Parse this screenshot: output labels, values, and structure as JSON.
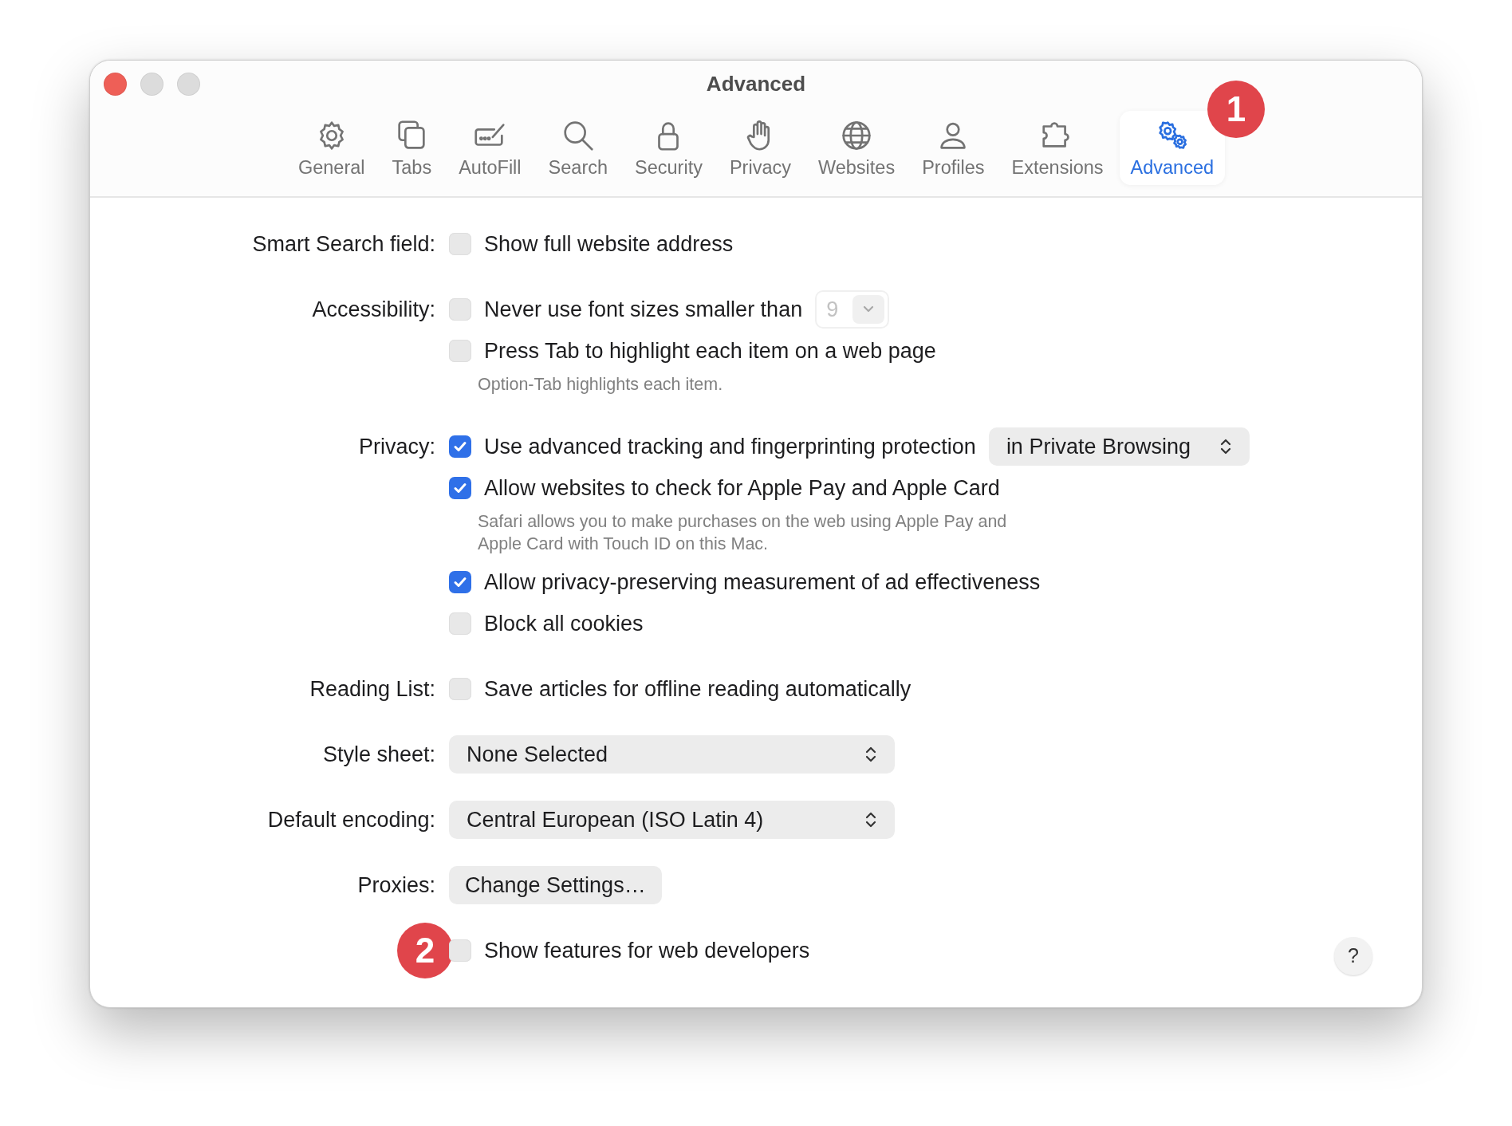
{
  "window": {
    "title": "Advanced"
  },
  "tabs": [
    {
      "label": "General",
      "selected": false
    },
    {
      "label": "Tabs",
      "selected": false
    },
    {
      "label": "AutoFill",
      "selected": false
    },
    {
      "label": "Search",
      "selected": false
    },
    {
      "label": "Security",
      "selected": false
    },
    {
      "label": "Privacy",
      "selected": false
    },
    {
      "label": "Websites",
      "selected": false
    },
    {
      "label": "Profiles",
      "selected": false
    },
    {
      "label": "Extensions",
      "selected": false
    },
    {
      "label": "Advanced",
      "selected": true,
      "badge": "1"
    }
  ],
  "sections": [
    {
      "label": "Smart Search field:",
      "items": [
        {
          "kind": "checkbox",
          "text": "Show full website address",
          "checked": false
        }
      ]
    },
    {
      "label": "Accessibility:",
      "items": [
        {
          "kind": "checkbox",
          "text": "Never use font sizes smaller than",
          "checked": false,
          "popup": {
            "value": "9",
            "disabled": true
          }
        },
        {
          "kind": "checkbox",
          "text": "Press Tab to highlight each item on a web page",
          "checked": false
        },
        {
          "kind": "hint",
          "text": "Option-Tab highlights each item."
        }
      ]
    },
    {
      "label": "Privacy:",
      "items": [
        {
          "kind": "checkbox",
          "text": "Use advanced tracking and fingerprinting protection",
          "checked": true,
          "popup": {
            "value": "in Private Browsing",
            "disabled": false
          }
        },
        {
          "kind": "checkbox",
          "text": "Allow websites to check for Apple Pay and Apple Card",
          "checked": true
        },
        {
          "kind": "hint",
          "text": "Safari allows you to make purchases on the web using Apple Pay and Apple Card with Touch ID on this Mac."
        },
        {
          "kind": "checkbox",
          "text": "Allow privacy-preserving measurement of ad effectiveness",
          "checked": true
        },
        {
          "kind": "checkbox",
          "text": "Block all cookies",
          "checked": false
        }
      ]
    },
    {
      "label": "Reading List:",
      "items": [
        {
          "kind": "checkbox",
          "text": "Save articles for offline reading automatically",
          "checked": false
        }
      ]
    },
    {
      "label": "Style sheet:",
      "items": [
        {
          "kind": "popup",
          "value": "None Selected"
        }
      ]
    },
    {
      "label": "Default encoding:",
      "items": [
        {
          "kind": "popup",
          "value": "Central European (ISO Latin 4)"
        }
      ]
    },
    {
      "label": "Proxies:",
      "items": [
        {
          "kind": "button",
          "text": "Change Settings…"
        }
      ]
    },
    {
      "badge": "2",
      "items": [
        {
          "kind": "checkbox",
          "text": "Show features for web developers",
          "checked": false
        }
      ]
    }
  ],
  "help_button": "?"
}
